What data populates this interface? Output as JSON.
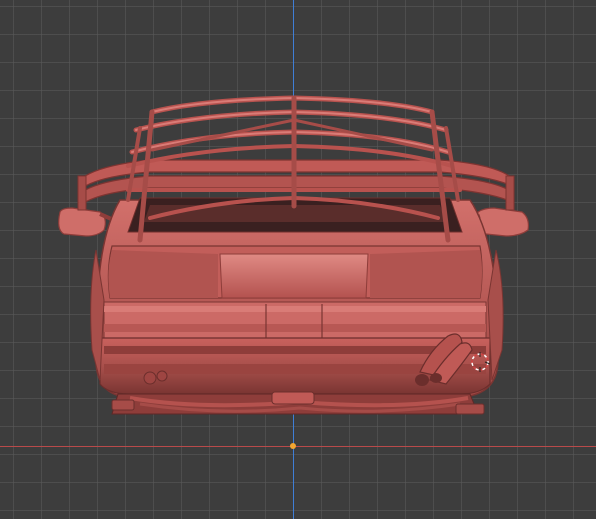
{
  "viewport": {
    "background": "#3d3d3d",
    "grid_color": "#5a5a5a",
    "y_axis_color": "#3f7ed6",
    "x_axis_color": "#b94a4a",
    "origin_color": "#f2a531"
  },
  "model": {
    "description": "car-rear-view-mesh",
    "base_color": "#c8625f"
  },
  "cursor_3d": {
    "icon": "3d-cursor-icon"
  }
}
